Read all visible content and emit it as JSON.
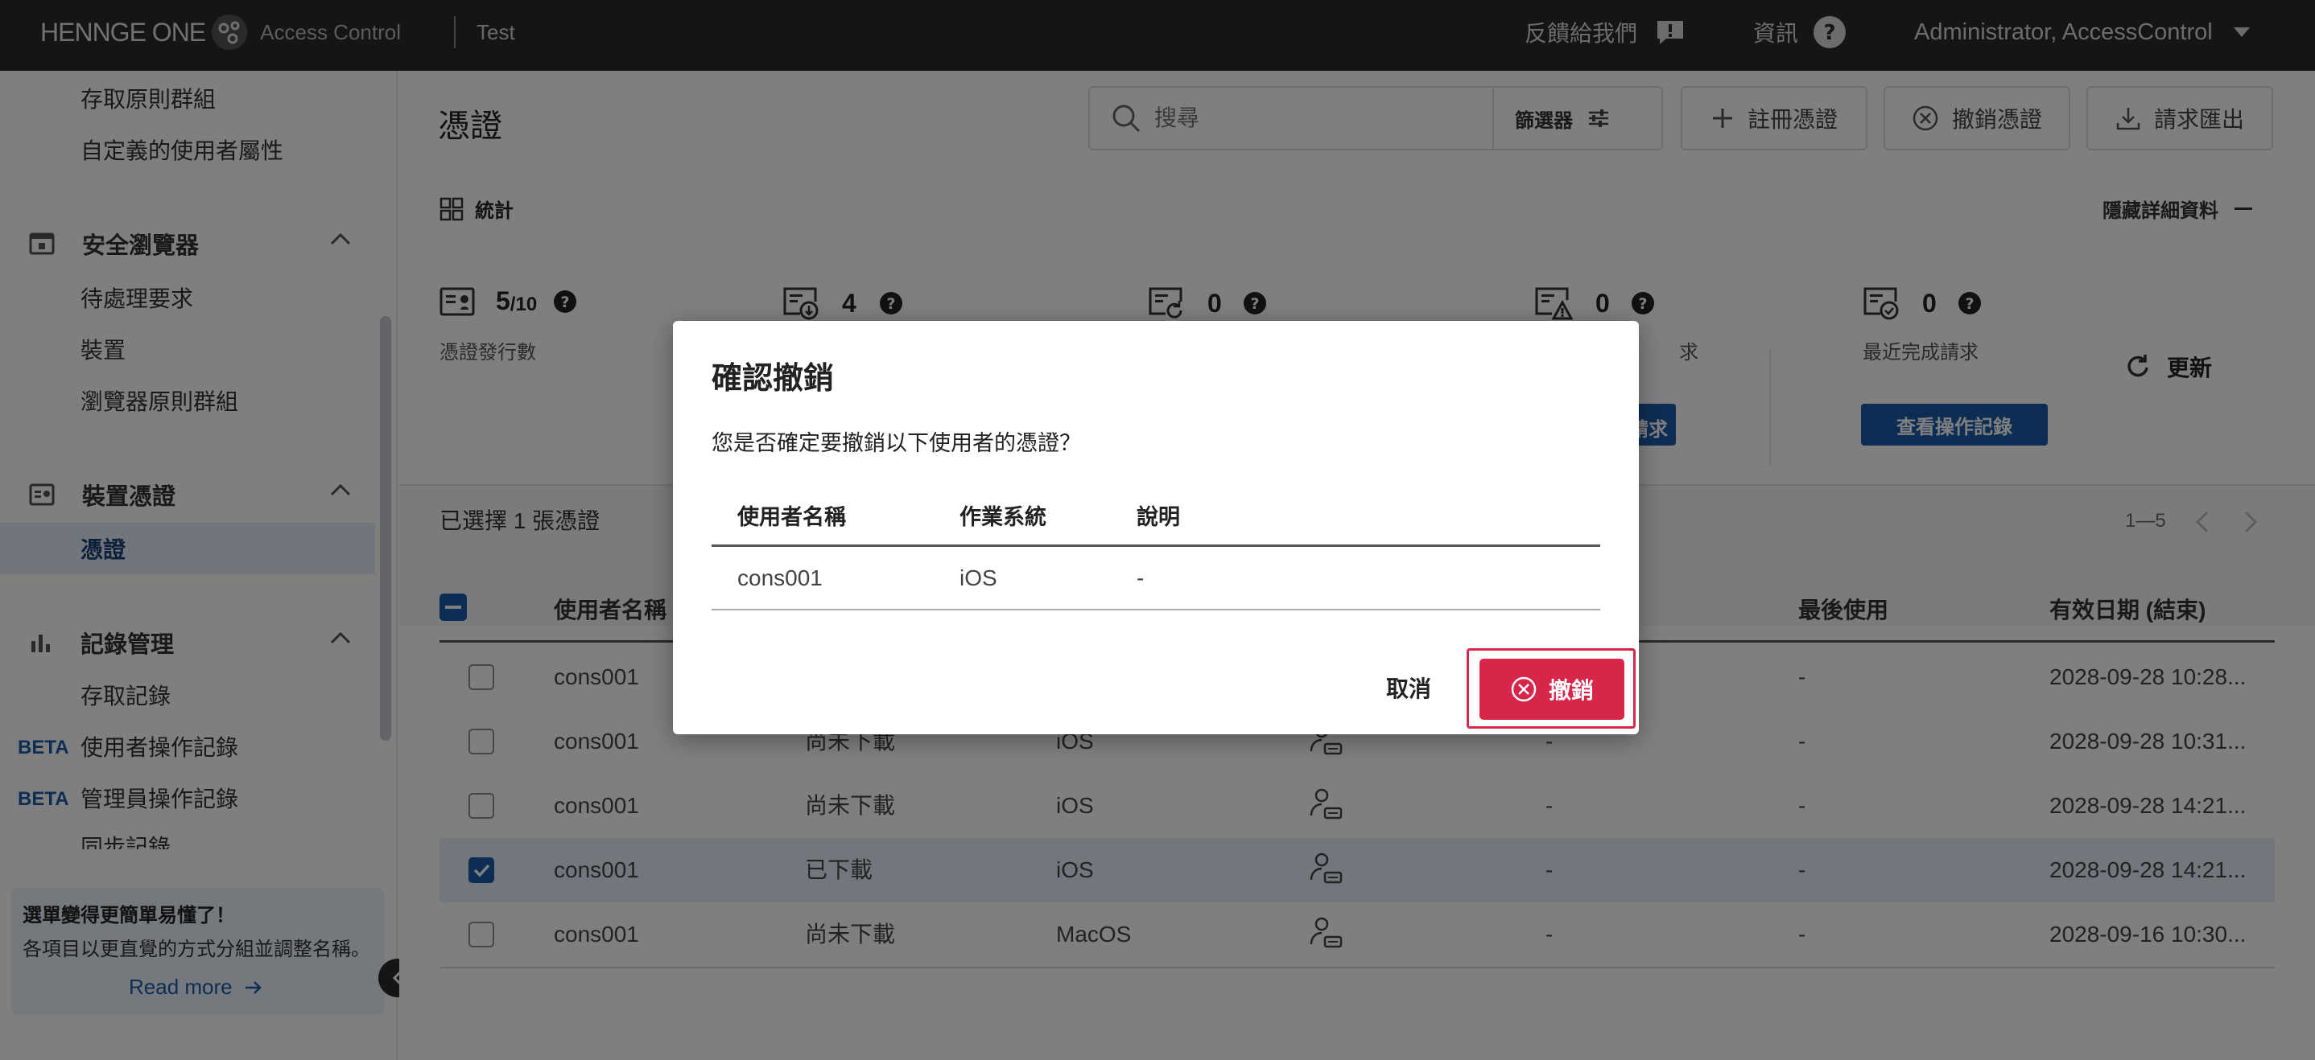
{
  "topbar": {
    "brand": "HENNGE ONE",
    "product": "Access Control",
    "tenant": "Test",
    "feedback": "反饋給我們",
    "info": "資訊",
    "user": "Administrator, AccessControl"
  },
  "sidebar": {
    "top_items": [
      "存取原則群組",
      "自定義的使用者屬性"
    ],
    "secure_browser": {
      "label": "安全瀏覽器",
      "items": [
        "待處理要求",
        "裝置",
        "瀏覽器原則群組"
      ]
    },
    "device_cert": {
      "label": "裝置憑證",
      "active_item": "憑證"
    },
    "logs": {
      "label": "記錄管理",
      "items": [
        "存取記錄",
        "使用者操作記錄",
        "管理員操作記錄",
        "同步記錄"
      ],
      "beta": "BETA"
    },
    "notice": {
      "title": "選單變得更簡單易懂了！",
      "body": "各項目以更直覺的方式分組並調整名稱。",
      "link": "Read more"
    }
  },
  "page": {
    "title": "憑證",
    "search_placeholder": "搜尋",
    "filter_label": "篩選器",
    "register_button": "註冊憑證",
    "revoke_button": "撤銷憑證",
    "export_button": "請求匯出"
  },
  "stats": {
    "section_label": "統計",
    "hide_details": "隱藏詳細資料",
    "issued_value": "5",
    "issued_total": "/10",
    "issued_label": "憑證發行數",
    "pending_download": "4",
    "renew_value": "0",
    "error_value": "0",
    "error_label_tail": "求",
    "error_button_tail": "請求",
    "completed_value": "0",
    "completed_label": "最近完成請求",
    "completed_button": "查看操作記錄",
    "refresh": "更新"
  },
  "list": {
    "selected_text": "已選擇 1 張憑證",
    "pagination": "1—5",
    "headers": {
      "username": "使用者名稱",
      "last_used": "最後使用",
      "expiry": "有效日期 (結束)"
    },
    "rows": [
      {
        "user": "cons001",
        "status": "",
        "os": "",
        "col5": "",
        "last": "-",
        "expiry": "2028-09-28 10:28...",
        "checked": false
      },
      {
        "user": "cons001",
        "status": "尚未下載",
        "os": "iOS",
        "col5": "-",
        "last": "-",
        "expiry": "2028-09-28 10:31...",
        "checked": false
      },
      {
        "user": "cons001",
        "status": "尚未下載",
        "os": "iOS",
        "col5": "-",
        "last": "-",
        "expiry": "2028-09-28 14:21...",
        "checked": false
      },
      {
        "user": "cons001",
        "status": "已下載",
        "os": "iOS",
        "col5": "-",
        "last": "-",
        "expiry": "2028-09-28 14:21...",
        "checked": true
      },
      {
        "user": "cons001",
        "status": "尚未下載",
        "os": "MacOS",
        "col5": "-",
        "last": "-",
        "expiry": "2028-09-16 10:30...",
        "checked": false
      }
    ]
  },
  "dialog": {
    "title": "確認撤銷",
    "message": "您是否確定要撤銷以下使用者的憑證？",
    "headers": [
      "使用者名稱",
      "作業系統",
      "說明"
    ],
    "row": [
      "cons001",
      "iOS",
      "-"
    ],
    "cancel": "取消",
    "confirm": "撤銷"
  },
  "colors": {
    "topbar": "#2b2b2b",
    "primary": "#1a5ca8",
    "danger": "#d7264a",
    "selected_row": "#e5eefb"
  }
}
